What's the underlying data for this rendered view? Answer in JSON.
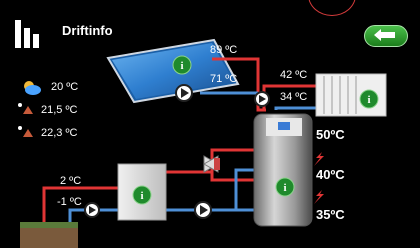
{
  "header": {
    "title": "Driftinfo"
  },
  "outdoor": {
    "weather_temp": "20 ºC",
    "sensor1_temp": "21,5 ºC",
    "sensor2_temp": "22,3 ºC"
  },
  "solar": {
    "temp_top": "89 ºC",
    "temp_return": "71 ºC"
  },
  "radiator": {
    "temp_supply": "42 ºC",
    "temp_return": "34 ºC"
  },
  "heat_pump": {
    "temp_top": "2 ºC",
    "temp_bottom": "-1 ºC"
  },
  "tank": {
    "temp_top": "50ºC",
    "temp_mid": "40ºC",
    "temp_bottom": "35ºC"
  },
  "colors": {
    "hot": "#e03535",
    "cold": "#4e8fd6",
    "info": "#1f8a2c"
  },
  "icons": [
    "logo-icon",
    "back-arrow-icon",
    "weather-icon",
    "info-icon",
    "pump-icon",
    "valve-icon",
    "lightning-icon"
  ]
}
